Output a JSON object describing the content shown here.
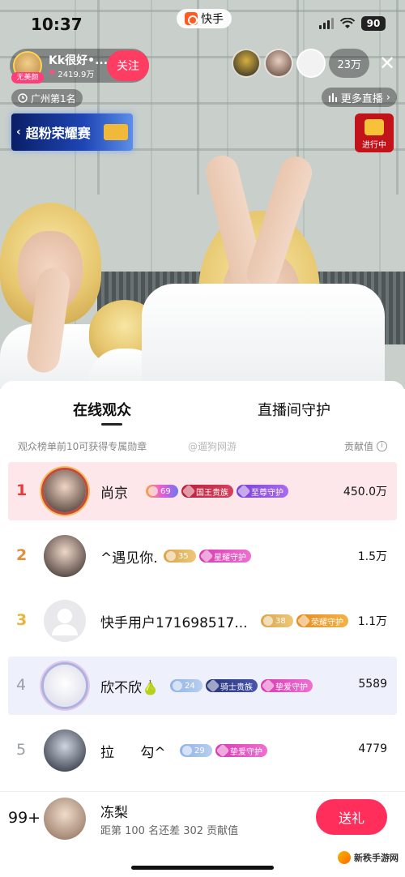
{
  "status_bar": {
    "time": "10:37",
    "app_name": "快手",
    "battery": "90"
  },
  "streamer": {
    "avatar_tag": "无美颜",
    "name": "Kk很好•...",
    "likes": "2419.9万",
    "follow_label": "关注"
  },
  "viewers": {
    "count": "23万"
  },
  "rank_badge": "广州第1名",
  "more_live": "更多直播",
  "banner": {
    "text": "超粉荣耀赛"
  },
  "live_box": {
    "label": "进行中"
  },
  "sheet": {
    "tabs": [
      "在线观众",
      "直播间守护"
    ],
    "info": "观众榜单前10可获得专属勋章",
    "watermark": "@遛狗网游",
    "contrib_label": "贡献值",
    "rows": [
      {
        "rank": "1",
        "name": "尚京",
        "level": "69",
        "tags": [
          "国王贵族",
          "至尊守护"
        ],
        "score": "450.0万"
      },
      {
        "rank": "2",
        "name": "^遇见你.",
        "level": "35",
        "tags": [
          "星耀守护"
        ],
        "score": "1.5万"
      },
      {
        "rank": "3",
        "name": "快手用户171698517...",
        "level": "38",
        "tags": [
          "荣耀守护"
        ],
        "score": "1.1万"
      },
      {
        "rank": "4",
        "name": "欣不欣🍐",
        "level": "24",
        "tags": [
          "骑士贵族",
          "挚爱守护"
        ],
        "score": "5589"
      },
      {
        "rank": "5",
        "name": "拉      勾^",
        "level": "29",
        "tags": [
          "挚爱守护"
        ],
        "score": "4779"
      }
    ]
  },
  "me": {
    "rank": "99+",
    "name": "冻梨",
    "sub": "距第 100 名还差 302 贡献值",
    "gift_label": "送礼"
  },
  "corner_logo": "新秩手游网",
  "colors": {
    "accent": "#ff2e5b",
    "top1_bg": "#fde7eb",
    "top4_bg": "#eef0fb"
  }
}
